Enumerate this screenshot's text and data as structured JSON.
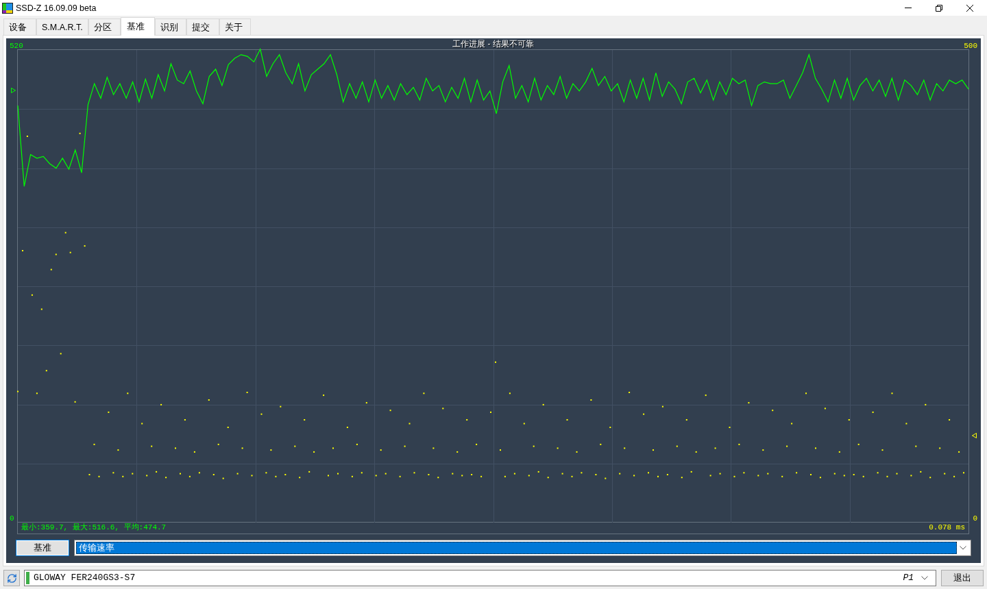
{
  "window": {
    "title": "SSD-Z 16.09.09 beta"
  },
  "tabs": [
    {
      "label": "设备",
      "selected": false
    },
    {
      "label": "S.M.A.R.T.",
      "selected": false
    },
    {
      "label": "分区",
      "selected": false
    },
    {
      "label": "基准",
      "selected": true
    },
    {
      "label": "识别",
      "selected": false
    },
    {
      "label": "提交",
      "selected": false
    },
    {
      "label": "关于",
      "selected": false
    }
  ],
  "benchmark": {
    "speed_chart": {
      "chart_data": {
        "type": "line",
        "title": "工作进展 - 结果不可靠",
        "ylim": [
          0,
          520
        ],
        "yticks": [
          0,
          520
        ],
        "series": [
          {
            "color": "#00ff00",
            "values": [
              454,
              365,
              400,
              396,
              398,
              390,
              385,
              396,
              384,
              405,
              380,
              455,
              478,
              462,
              485,
              466,
              478,
              462,
              480,
              458,
              483,
              462,
              488,
              470,
              500,
              482,
              478,
              492,
              470,
              456,
              486,
              494,
              476,
              499,
              506,
              510,
              508,
              502,
              516,
              486,
              500,
              510,
              490,
              478,
              500,
              470,
              488,
              494,
              500,
              510,
              488,
              458,
              478,
              462,
              480,
              458,
              482,
              462,
              476,
              460,
              478,
              466,
              474,
              460,
              484,
              470,
              476,
              458,
              474,
              462,
              484,
              458,
              482,
              460,
              470,
              445,
              480,
              498,
              462,
              476,
              458,
              484,
              460,
              476,
              466,
              486,
              462,
              478,
              470,
              480,
              495,
              476,
              486,
              470,
              478,
              458,
              482,
              462,
              484,
              460,
              490,
              464,
              480,
              472,
              456,
              480,
              484,
              468,
              482,
              460,
              480,
              466,
              484,
              478,
              482,
              454,
              476,
              480,
              478,
              478,
              482,
              462,
              476,
              490,
              510,
              484,
              472,
              458,
              482,
              462,
              484,
              460,
              476,
              484,
              470,
              482,
              464,
              484,
              460,
              482,
              476,
              466,
              482,
              460,
              478,
              470,
              482,
              478,
              482,
              472
            ]
          }
        ]
      }
    },
    "access_axis": {
      "top_label": "500",
      "bottom_label": "0"
    },
    "speed_stats": "最小:359.7, 最大:516.6, 平均:474.7",
    "access_stats": "0.078 ms",
    "run_button": "基准",
    "test_select": {
      "value": "传输速率"
    }
  },
  "status_bar": {
    "drive_select": {
      "value": "GLOWAY FER240GS3-S7",
      "port": "P1"
    },
    "exit_button": "退出"
  }
}
